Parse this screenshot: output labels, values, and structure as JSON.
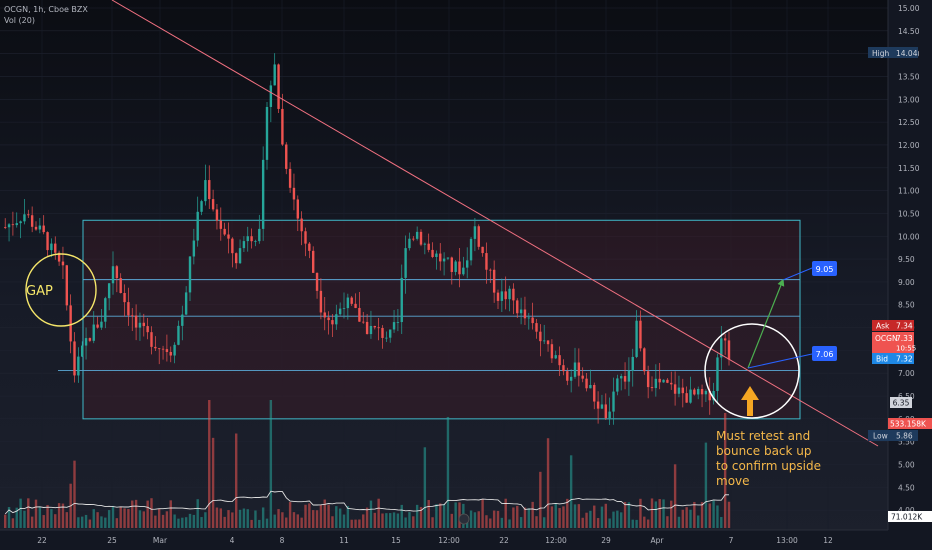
{
  "header": {
    "symbol_line": "OCGN, 1h, Cboe BZX",
    "volume_label": "Vol (20)"
  },
  "price_axis": {
    "ticks": [
      "15.00",
      "14.50",
      "14.00",
      "13.50",
      "13.00",
      "12.50",
      "12.00",
      "11.50",
      "11.00",
      "10.50",
      "10.00",
      "9.50",
      "9.00",
      "8.50",
      "8.00",
      "7.50",
      "7.00",
      "6.50",
      "6.00",
      "5.50",
      "5.00",
      "4.50",
      "4.00"
    ],
    "high_label": "High",
    "high_value": "14.04",
    "low_label": "Low",
    "low_value": "5.86",
    "ask_label": "Ask",
    "ask_value": "7.34",
    "symbol_tag": "OCGN",
    "last_value": "7.33",
    "countdown": "10:55",
    "bid_label": "Bid",
    "bid_value": "7.32",
    "level_635": "6.35",
    "volume_tag": "533.158K",
    "volume_ma_tag": "71.012K"
  },
  "time_axis": {
    "labels": [
      "22",
      "25",
      "Mar",
      "4",
      "8",
      "11",
      "15",
      "12:00",
      "22",
      "12:00",
      "29",
      "Apr",
      "7",
      "13:00",
      "12"
    ]
  },
  "annotations": {
    "gap": "GAP",
    "target_upper": "9.05",
    "target_lower": "7.06",
    "note_lines": [
      "Must retest and",
      "bounce back up",
      "to confirm upside",
      "move"
    ]
  },
  "colors": {
    "background": "#131722",
    "up_candle": "#26a69a",
    "down_candle": "#ef5350",
    "box_border": "#3fb8c8",
    "trendline": "#f07080",
    "gap_circle": "#f5e66a",
    "note_text": "#f5b84a",
    "arrow_up": "#f5a623",
    "target_tag": "#2962ff",
    "green_arrow": "#4caf50"
  },
  "chart_data": {
    "type": "candlestick",
    "symbol": "OCGN",
    "interval": "1h",
    "exchange": "Cboe BZX",
    "ylim": [
      4.0,
      15.0
    ],
    "x_tick_labels": [
      "22",
      "25",
      "Mar",
      "4",
      "8",
      "11",
      "15",
      "12:00",
      "22",
      "12:00",
      "29",
      "Apr",
      "7",
      "13:00",
      "12"
    ],
    "session_high": 14.04,
    "session_low": 5.86,
    "ask": 7.34,
    "last": 7.33,
    "bid": 7.32,
    "range_box": {
      "top": 10.35,
      "bottom": 6.0
    },
    "horizontal_levels": [
      9.05,
      8.25,
      7.06
    ],
    "projection_targets": [
      9.05,
      7.06
    ],
    "price_path": [
      [
        0,
        10.2
      ],
      [
        5,
        10.5
      ],
      [
        10,
        10.0
      ],
      [
        15,
        9.2
      ],
      [
        18,
        7.0
      ],
      [
        21,
        7.7
      ],
      [
        25,
        8.2
      ],
      [
        28,
        9.4
      ],
      [
        31,
        8.6
      ],
      [
        34,
        8.0
      ],
      [
        37,
        7.8
      ],
      [
        40,
        7.6
      ],
      [
        43,
        7.5
      ],
      [
        46,
        8.3
      ],
      [
        49,
        10.0
      ],
      [
        52,
        11.2
      ],
      [
        55,
        10.4
      ],
      [
        58,
        9.8
      ],
      [
        60,
        9.5
      ],
      [
        63,
        10.1
      ],
      [
        66,
        10.0
      ],
      [
        68,
        13.0
      ],
      [
        70,
        13.7
      ],
      [
        72,
        12.0
      ],
      [
        74,
        11.2
      ],
      [
        76,
        10.4
      ],
      [
        79,
        9.6
      ],
      [
        82,
        8.5
      ],
      [
        85,
        8.1
      ],
      [
        88,
        8.6
      ],
      [
        91,
        8.3
      ],
      [
        94,
        8.0
      ],
      [
        97,
        7.9
      ],
      [
        100,
        7.8
      ],
      [
        102,
        8.1
      ],
      [
        104,
        9.9
      ],
      [
        107,
        10.1
      ],
      [
        110,
        9.7
      ],
      [
        113,
        9.5
      ],
      [
        116,
        9.3
      ],
      [
        119,
        9.3
      ],
      [
        122,
        10.2
      ],
      [
        125,
        9.3
      ],
      [
        128,
        8.7
      ],
      [
        131,
        8.7
      ],
      [
        134,
        8.3
      ],
      [
        137,
        8.0
      ],
      [
        140,
        7.6
      ],
      [
        143,
        7.4
      ],
      [
        146,
        7.0
      ],
      [
        149,
        7.1
      ],
      [
        152,
        6.6
      ],
      [
        155,
        6.2
      ],
      [
        157,
        6.0
      ],
      [
        159,
        6.9
      ],
      [
        162,
        6.9
      ],
      [
        164,
        8.0
      ],
      [
        166,
        6.9
      ],
      [
        169,
        6.8
      ],
      [
        172,
        6.7
      ],
      [
        175,
        6.6
      ],
      [
        177,
        6.5
      ],
      [
        180,
        6.5
      ],
      [
        182,
        6.45
      ],
      [
        184,
        6.7
      ],
      [
        186,
        7.9
      ],
      [
        188,
        7.33
      ]
    ],
    "volume_ma_last": "71.012K",
    "volume_last": "533.158K"
  }
}
